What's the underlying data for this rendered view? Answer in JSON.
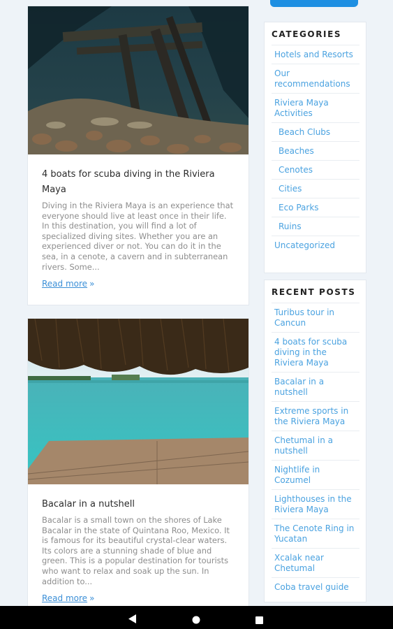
{
  "posts": [
    {
      "title": "4 boats for scuba diving in the Riviera Maya",
      "excerpt": "Diving in the Riviera Maya is an experience that everyone should live at least once in their life. In this destination, you will find a lot of specialized diving sites. Whether you are an experienced diver or not. You can do it in the sea, in a cenote, a cavern and in subterranean rivers. Some...",
      "read_more": "Read more"
    },
    {
      "title": "Bacalar in a nutshell",
      "excerpt": "Bacalar is a small town on the shores of Lake Bacalar in the state of Quintana Roo, Mexico. It is famous for its beautiful crystal-clear waters. Its colors are a stunning shade of blue and green. This is a popular destination for tourists who want to relax and soak up the sun. In addition to...",
      "read_more": "Read more"
    }
  ],
  "categories": {
    "title": "CATEGORIES",
    "items": [
      {
        "label": "Hotels and Resorts",
        "sub": false
      },
      {
        "label": "Our recommendations",
        "sub": false
      },
      {
        "label": "Riviera Maya Activities",
        "sub": false
      },
      {
        "label": "Beach Clubs",
        "sub": true
      },
      {
        "label": "Beaches",
        "sub": true
      },
      {
        "label": "Cenotes",
        "sub": true
      },
      {
        "label": "Cities",
        "sub": true
      },
      {
        "label": "Eco Parks",
        "sub": true
      },
      {
        "label": "Ruins",
        "sub": true
      },
      {
        "label": "Uncategorized",
        "sub": false
      }
    ]
  },
  "recent_posts": {
    "title": "RECENT POSTS",
    "items": [
      "Turibus tour in Cancun",
      "4 boats for scuba diving in the Riviera Maya",
      "Bacalar in a nutshell",
      "Extreme sports in the Riviera Maya",
      "Chetumal in a nutshell",
      "Nightlife in Cozumel",
      "Lighthouses in the Riviera Maya",
      "The Cenote Ring in Yucatan",
      "Xcalak near Chetumal",
      "Coba travel guide"
    ]
  },
  "icons": {
    "read_more_arrow": "double-chevron-right-icon",
    "nav_back": "triangle-back-icon",
    "nav_home": "circle-home-icon",
    "nav_recent": "square-recents-icon"
  },
  "colors": {
    "link": "#4aa2e0",
    "button": "#1e8fe2",
    "page_bg": "#eef3f8"
  }
}
